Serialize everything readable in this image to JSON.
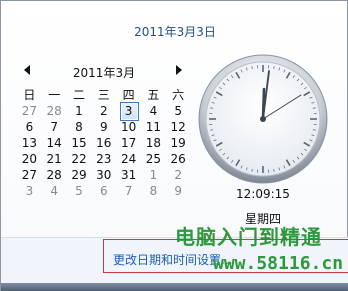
{
  "header": {
    "date_long": "2011年3月3日"
  },
  "calendar": {
    "month_label": "2011年3月",
    "weekdays": [
      "日",
      "一",
      "二",
      "三",
      "四",
      "五",
      "六"
    ],
    "weeks": [
      [
        "27",
        "28",
        "1",
        "2",
        "3",
        "4",
        "5"
      ],
      [
        "6",
        "7",
        "8",
        "9",
        "10",
        "11",
        "12"
      ],
      [
        "13",
        "14",
        "15",
        "16",
        "17",
        "18",
        "19"
      ],
      [
        "20",
        "21",
        "22",
        "23",
        "24",
        "25",
        "26"
      ],
      [
        "27",
        "28",
        "29",
        "30",
        "31",
        "1",
        "2"
      ],
      [
        "3",
        "4",
        "5",
        "6",
        "7",
        "8",
        "9"
      ]
    ],
    "today": "3",
    "prev_icon": "triangle-left-icon",
    "next_icon": "triangle-right-icon"
  },
  "clock": {
    "time_text": "12:09:15",
    "day_text": "星期四"
  },
  "footer": {
    "settings_link": "更改日期和时间设置..."
  },
  "watermark": {
    "title": "电脑入门到精通",
    "url": "www.58116.cn"
  },
  "colors": {
    "accent": "#1e4f8f",
    "link": "#1a5fb4",
    "highlight_border": "#d03a3a",
    "watermark": "#2c9a3a"
  }
}
